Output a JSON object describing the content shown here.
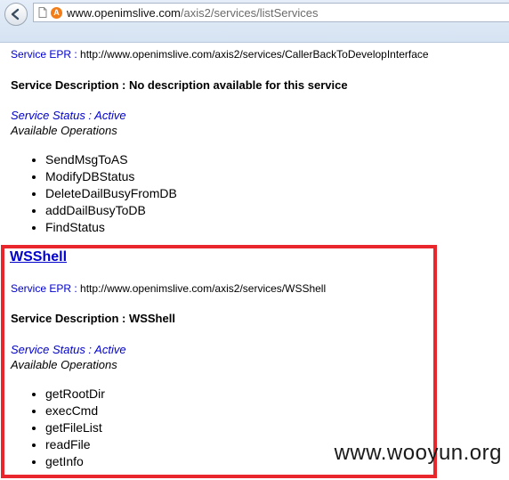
{
  "browser": {
    "back_icon": "back-arrow-icon",
    "page_icon": "page-icon",
    "site_icon": "site-favicon-icon",
    "site_icon_letter": "A",
    "url_host": "www.openimslive.com",
    "url_path": "/axis2/services/listServices"
  },
  "previous_service": {
    "epr_label": "Service EPR :",
    "epr_value": "http://www.openimslive.com/axis2/services/CallerBackToDevelopInterface",
    "description": "Service Description : No description available for this service",
    "status": "Service Status : Active",
    "available_operations": "Available Operations",
    "operations": [
      "SendMsgToAS",
      "ModifyDBStatus",
      "DeleteDailBusyFromDB",
      "addDailBusyToDB",
      "FindStatus"
    ]
  },
  "highlighted_service": {
    "name": "WSShell",
    "epr_label": "Service EPR :",
    "epr_value": "http://www.openimslive.com/axis2/services/WSShell",
    "description": "Service Description : WSShell",
    "status": "Service Status : Active",
    "available_operations": "Available Operations",
    "operations": [
      "getRootDir",
      "execCmd",
      "getFileList",
      "readFile",
      "getInfo"
    ]
  },
  "highlight_color": "#e8262b",
  "link_color": "#0000cc",
  "watermark": "www.wooyun.org"
}
